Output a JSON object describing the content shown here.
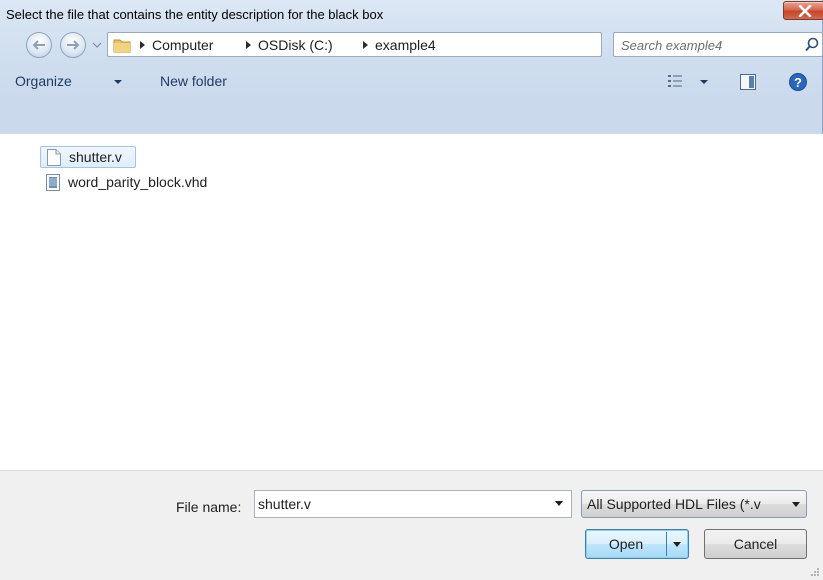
{
  "window": {
    "title": "Select the file that contains the entity description for the black box"
  },
  "address": {
    "crumbs": [
      "Computer",
      "OSDisk (C:)",
      "example4"
    ],
    "search_placeholder": "Search example4"
  },
  "toolbar": {
    "organize_label": "Organize",
    "new_folder_label": "New folder"
  },
  "files": [
    {
      "name": "shutter.v",
      "selected": true,
      "icon": "blank-file-icon"
    },
    {
      "name": "word_parity_block.vhd",
      "selected": false,
      "icon": "text-file-icon"
    }
  ],
  "bottom": {
    "file_name_label": "File name:",
    "file_name_value": "shutter.v",
    "file_type_value": "All Supported HDL Files (*.v",
    "open_label": "Open",
    "cancel_label": "Cancel"
  },
  "colors": {
    "accent": "#3c7fb1",
    "close_button": "#c6452b",
    "selection": "#dfeefc"
  }
}
